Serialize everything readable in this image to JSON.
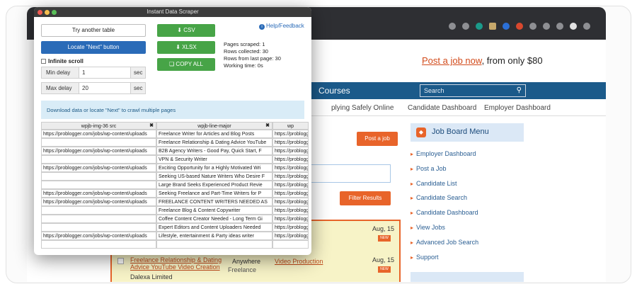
{
  "popup": {
    "title": "Instant Data Scraper",
    "try_another_table": "Try another table",
    "locate_next": "Locate \"Next\" button",
    "infinite_scroll": "Infinite scroll",
    "min_delay_label": "Min delay",
    "min_delay_value": "1",
    "max_delay_label": "Max delay",
    "max_delay_value": "20",
    "delay_unit": "sec",
    "csv_button": "CSV",
    "xlsx_button": "XLSX",
    "copy_all_button": "COPY ALL",
    "help_feedback": "Help/Feedback",
    "stats": {
      "pages_scraped": "Pages scraped: 1",
      "rows_collected": "Rows collected: 30",
      "rows_last_page": "Rows from last page: 30",
      "working_time": "Working time: 0s"
    },
    "info_banner": "Download data or locate \"Next\" to crawl multiple pages",
    "table": {
      "headers": [
        "wpjb-img-36 src",
        "wpjb-line-major",
        "wp"
      ],
      "rows": [
        [
          "https://problogger.com/jobs/wp-content/uploads",
          "Freelance Writer for Articles and Blog Posts",
          "https://problogge"
        ],
        [
          "",
          "Freelance Relationship & Dating Advice YouTube",
          "https://problogge"
        ],
        [
          "https://problogger.com/jobs/wp-content/uploads",
          "B2B Agency Writers - Good Pay, Quick Start, F",
          "https://problogge"
        ],
        [
          "",
          "VPN & Security Writer",
          "https://problogge"
        ],
        [
          "https://problogger.com/jobs/wp-content/uploads",
          "Exciting Opportunity for a Highly Motivated Wri",
          "https://problogge"
        ],
        [
          "",
          "Seeking US-based Nature Writers Who Desire F",
          "https://problogge"
        ],
        [
          "",
          "Large Brand Seeks Experienced Product Revie",
          "https://problogge"
        ],
        [
          "https://problogger.com/jobs/wp-content/uploads",
          "Seeking Freelance and Part-Time Writers for P",
          "https://problogge"
        ],
        [
          "https://problogger.com/jobs/wp-content/uploads",
          "FREELANCE CONTENT WRITERS NEEDED AS",
          "https://problogge"
        ],
        [
          "",
          "Freelance Blog & Content Copywriter",
          "https://problogge"
        ],
        [
          "",
          "Coffee Content Creator Needed - Long Term Gi",
          "https://problogge"
        ],
        [
          "",
          "Expert Editors and Content Uploaders Needed",
          "https://problogge"
        ],
        [
          "https://problogger.com/jobs/wp-content/uploads",
          "Lifestyle, entertainment & Party ideas writer",
          "https://problogge"
        ],
        [
          "",
          "",
          ""
        ]
      ]
    }
  },
  "site": {
    "post_job_link": "Post a job now",
    "post_job_suffix": ", from only $80",
    "nav_courses": "Courses",
    "search_placeholder": "Search",
    "subnav": [
      "plying Safely Online",
      "Candidate Dashboard",
      "Employer Dashboard"
    ],
    "post_a_job_button": "Post a job",
    "filter_results_button": "Filter Results",
    "menu_title": "Job Board Menu",
    "menu_items": [
      "Employer Dashboard",
      "Post a Job",
      "Candidate List",
      "Candidate Search",
      "Candidate Dashboard",
      "View Jobs",
      "Advanced Job Search",
      "Support"
    ],
    "listing": {
      "date1": "Aug, 15",
      "date2": "Aug, 15",
      "new1": "NEW",
      "new2": "NEW",
      "article_link": "icle",
      "title": "Freelance Relationship & Dating Advice YouTube Video Creation",
      "location": "Anywhere",
      "type": "Freelance",
      "category": "Video Production",
      "company": "Dalexa Limited"
    }
  }
}
